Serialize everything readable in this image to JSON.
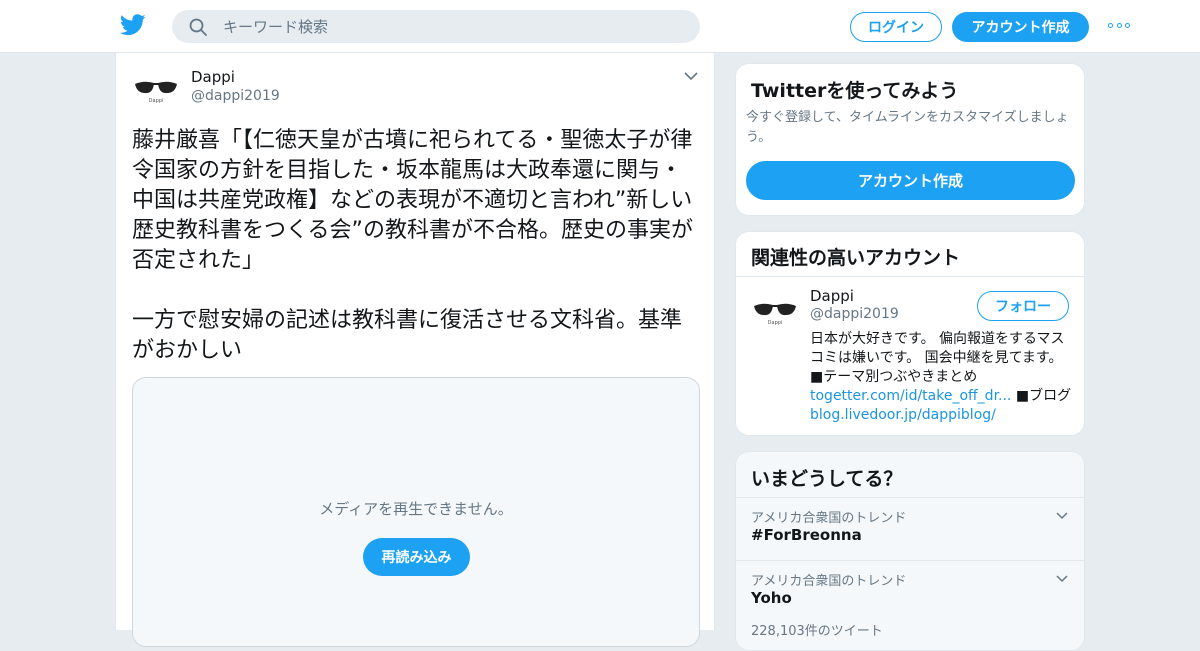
{
  "header": {
    "logo": "twitter-bird-icon",
    "search_placeholder": "キーワード検索",
    "login_label": "ログイン",
    "signup_label": "アカウント作成",
    "more_icon": "more-dots-icon"
  },
  "tweet": {
    "author_name": "Dappi",
    "author_handle": "@dappi2019",
    "text": "藤井厳喜「【仁徳天皇が古墳に祀られてる・聖徳太子が律令国家の方針を目指した・坂本龍馬は大政奉還に関与・中国は共産党政権】などの表現が不適切と言われ”新しい歴史教科書をつくる会”の教科書が不合格。歴史の事実が否定された」\n\n一方で慰安婦の記述は教科書に復活させる文科省。基準がおかしい",
    "media_message": "メディアを再生できません。",
    "reload_label": "再読み込み"
  },
  "signup_card": {
    "title": "Twitterを使ってみよう",
    "description": "今すぐ登録して、タイムラインをカスタマイズしましょう。",
    "button_label": "アカウント作成"
  },
  "related_card": {
    "title": "関連性の高いアカウント",
    "name": "Dappi",
    "handle": "@dappi2019",
    "follow_label": "フォロー",
    "bio_text": "日本が大好きです。 偏向報道をするマスコミは嫌いです。 国会中継を見てます。 ■テーマ別つぶやきまとめ ",
    "bio_link1": "togetter.com/id/take_off_dr...",
    "bio_mid": " ■ブログ ",
    "bio_link2": "blog.livedoor.jp/dappiblog/"
  },
  "trends_card": {
    "title": "いまどうしてる？",
    "trends": [
      {
        "context": "アメリカ合衆国のトレンド",
        "name": "#ForBreonna",
        "count": ""
      },
      {
        "context": "アメリカ合衆国のトレンド",
        "name": "Yoho",
        "count": "228,103件のツイート"
      }
    ]
  },
  "colors": {
    "accent": "#1da1f2",
    "link": "#1b95e0",
    "background": "#e6ecf0",
    "secondary_text": "#657786"
  }
}
